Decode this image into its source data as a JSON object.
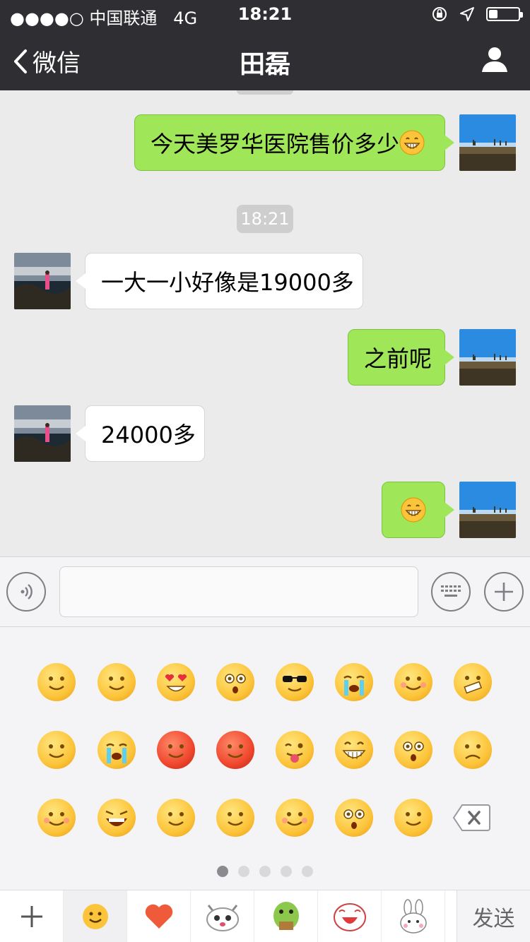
{
  "status_bar": {
    "carrier": "●●●●○ 中国联通",
    "network": "4G",
    "time": "18:21",
    "battery_level": 0.3
  },
  "nav": {
    "back_label": "微信",
    "title": "田磊",
    "profile_icon": "person-icon"
  },
  "chat": {
    "timestamp": "18:21",
    "messages": [
      {
        "from": "me",
        "text": "今天美罗华医院售价多少",
        "emoji": "grin-emoji"
      },
      {
        "from": "them",
        "text": "一大一小好像是19000多"
      },
      {
        "from": "me",
        "text": "之前呢"
      },
      {
        "from": "them",
        "text": "24000多"
      },
      {
        "from": "me",
        "text": "",
        "emoji": "grin-emoji"
      }
    ]
  },
  "input_bar": {
    "voice_icon": "voice-icon",
    "keyboard_icon": "keyboard-icon",
    "plus_icon": "plus-icon",
    "text_value": ""
  },
  "emoji_panel": {
    "emojis": [
      "smile",
      "grimace",
      "heart-eyes",
      "angry-stare",
      "sunglasses",
      "cry",
      "blush-angry",
      "zipped",
      "sleepy",
      "tears",
      "red-sweat",
      "furious",
      "tongue-wink",
      "grin",
      "shocked",
      "frown",
      "pouty",
      "scream",
      "dizzy",
      "facepalm",
      "shy-smile",
      "surprised",
      "confused"
    ],
    "delete_icon": "backspace-icon",
    "page_count": 5,
    "active_page": 1
  },
  "bottom_bar": {
    "tabs": [
      "plus-icon",
      "smiley-tab-icon",
      "heart-tab-icon",
      "cat-sticker-icon",
      "dino-sticker-icon",
      "laugh-sticker-icon",
      "rabbit-sticker-icon"
    ],
    "send_label": "发送"
  },
  "colors": {
    "nav_bg": "#2f2f33",
    "bubble_me": "#9fe658",
    "bubble_them": "#ffffff",
    "chat_bg": "#ebebeb"
  }
}
